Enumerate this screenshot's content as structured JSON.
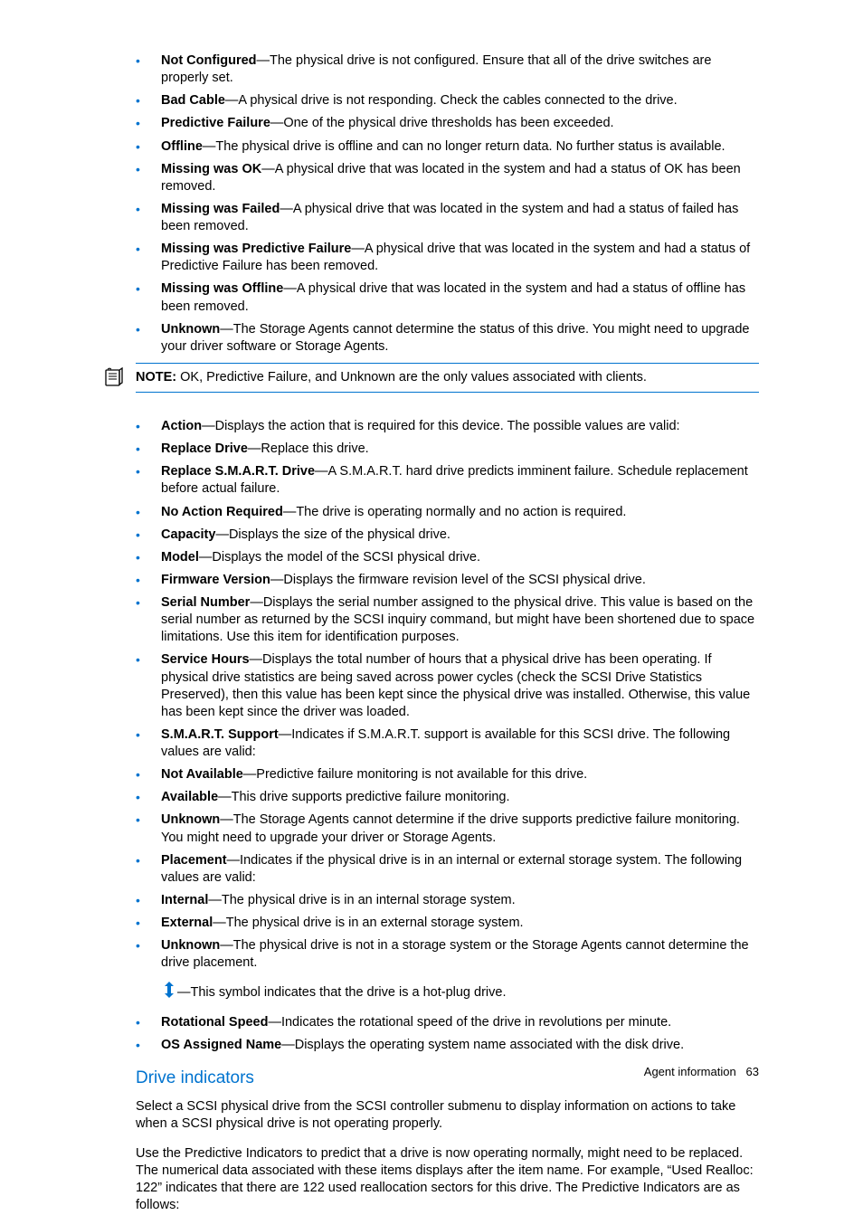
{
  "topList": [
    {
      "term": "Not Configured",
      "text": "—The physical drive is not configured. Ensure that all of the drive switches are properly set."
    },
    {
      "term": "Bad Cable",
      "text": "—A physical drive is not responding. Check the cables connected to the drive."
    },
    {
      "term": "Predictive Failure",
      "text": "—One of the physical drive thresholds has been exceeded."
    },
    {
      "term": "Offline",
      "text": "—The physical drive is offline and can no longer return data. No further status is available."
    },
    {
      "term": "Missing was OK",
      "text": "—A physical drive that was located in the system and had a status of OK has been removed."
    },
    {
      "term": "Missing was Failed",
      "text": "—A physical drive that was located in the system and had a status of failed has been removed."
    },
    {
      "term": "Missing was Predictive Failure",
      "text": "—A physical drive that was located in the system and had a status of Predictive Failure has been removed."
    },
    {
      "term": "Missing was Offline",
      "text": "—A physical drive that was located in the system and had a status of offline has been removed."
    },
    {
      "term": "Unknown",
      "text": "—The Storage Agents cannot determine the status of this drive. You might need to upgrade your driver software or Storage Agents."
    }
  ],
  "note": {
    "label": "NOTE:",
    "text": "  OK, Predictive Failure, and Unknown are the only values associated with clients."
  },
  "rows": [
    {
      "lvl": "lvl2",
      "term": "Action",
      "text": "—Displays the action that is required for this device. The possible values are valid:"
    },
    {
      "lvl": "lvl3",
      "term": "Replace Drive",
      "text": "—Replace this drive."
    },
    {
      "lvl": "lvl3",
      "term": "Replace S.M.A.R.T. Drive",
      "text": "—A S.M.A.R.T. hard drive predicts imminent failure. Schedule replacement before actual failure."
    },
    {
      "lvl": "lvl3",
      "term": "No Action Required",
      "text": "—The drive is operating normally and no action is required."
    },
    {
      "lvl": "lvl2",
      "term": "Capacity",
      "text": "—Displays the size of the physical drive."
    },
    {
      "lvl": "lvl3",
      "term": "Model",
      "text": "—Displays the model of the SCSI physical drive."
    },
    {
      "lvl": "lvl4",
      "term": "Firmware Version",
      "text": "—Displays the firmware revision level of the SCSI physical drive."
    },
    {
      "lvl": "lvl1",
      "term": "Serial Number",
      "text": "—Displays the serial number assigned to the physical drive. This value is based on the serial number as returned by the SCSI inquiry command, but might have been shortened due to space limitations. Use this item for identification purposes."
    },
    {
      "lvl": "lvl1",
      "term": "Service Hours",
      "text": "—Displays the total number of hours that a physical drive has been operating. If physical drive statistics are being saved across power cycles (check the SCSI Drive Statistics Preserved), then this value has been kept since the physical drive was installed. Otherwise, this value has been kept since the driver was loaded."
    },
    {
      "lvl": "lvl1",
      "term": "S.M.A.R.T. Support",
      "text": "—Indicates if S.M.A.R.T. support is available for this SCSI drive. The following values are valid:"
    },
    {
      "lvl": "lvl3",
      "term": "Not Available",
      "text": "—Predictive failure monitoring is not available for this drive."
    },
    {
      "lvl": "lvl3",
      "term": "Available",
      "text": "—This drive supports predictive failure monitoring."
    },
    {
      "lvl": "lvl3",
      "term": "Unknown",
      "text": "—The Storage Agents cannot determine if the drive supports predictive failure monitoring. You might need to upgrade your driver or Storage Agents."
    },
    {
      "lvl": "lvl1",
      "term": "Placement",
      "text": "—Indicates if the physical drive is in an internal or external storage system. The following values are valid:"
    },
    {
      "lvl": "lvl3",
      "term": "Internal",
      "text": "—The physical drive is in an internal storage system."
    },
    {
      "lvl": "lvl3",
      "term": "External",
      "text": "—The physical drive is in an external storage system."
    },
    {
      "lvl": "lvl3",
      "term": "Unknown",
      "text": "—The physical drive is not in a storage system or the Storage Agents cannot determine the drive placement."
    }
  ],
  "hotplug": "—This symbol indicates that the drive is a hot-plug drive.",
  "bottomRows": [
    {
      "lvl": "lvl2",
      "term": "Rotational Speed",
      "text": "—Indicates the rotational speed of the drive in revolutions per minute."
    },
    {
      "lvl": "lvl2",
      "term": "OS Assigned Name",
      "text": "—Displays the operating system name associated with the disk drive."
    }
  ],
  "heading": "Drive indicators",
  "para1": "Select a SCSI physical drive from the SCSI controller submenu to display information on actions to take when a SCSI physical drive is not operating properly.",
  "para2": "Use the Predictive Indicators to predict that a drive is now operating normally, might need to be replaced. The numerical data associated with these items displays after the item name. For example, “Used Realloc: 122” indicates that there are 122 used reallocation sectors for this drive. The Predictive Indicators are as follows:",
  "footer": {
    "label": "Agent information",
    "page": "63"
  }
}
